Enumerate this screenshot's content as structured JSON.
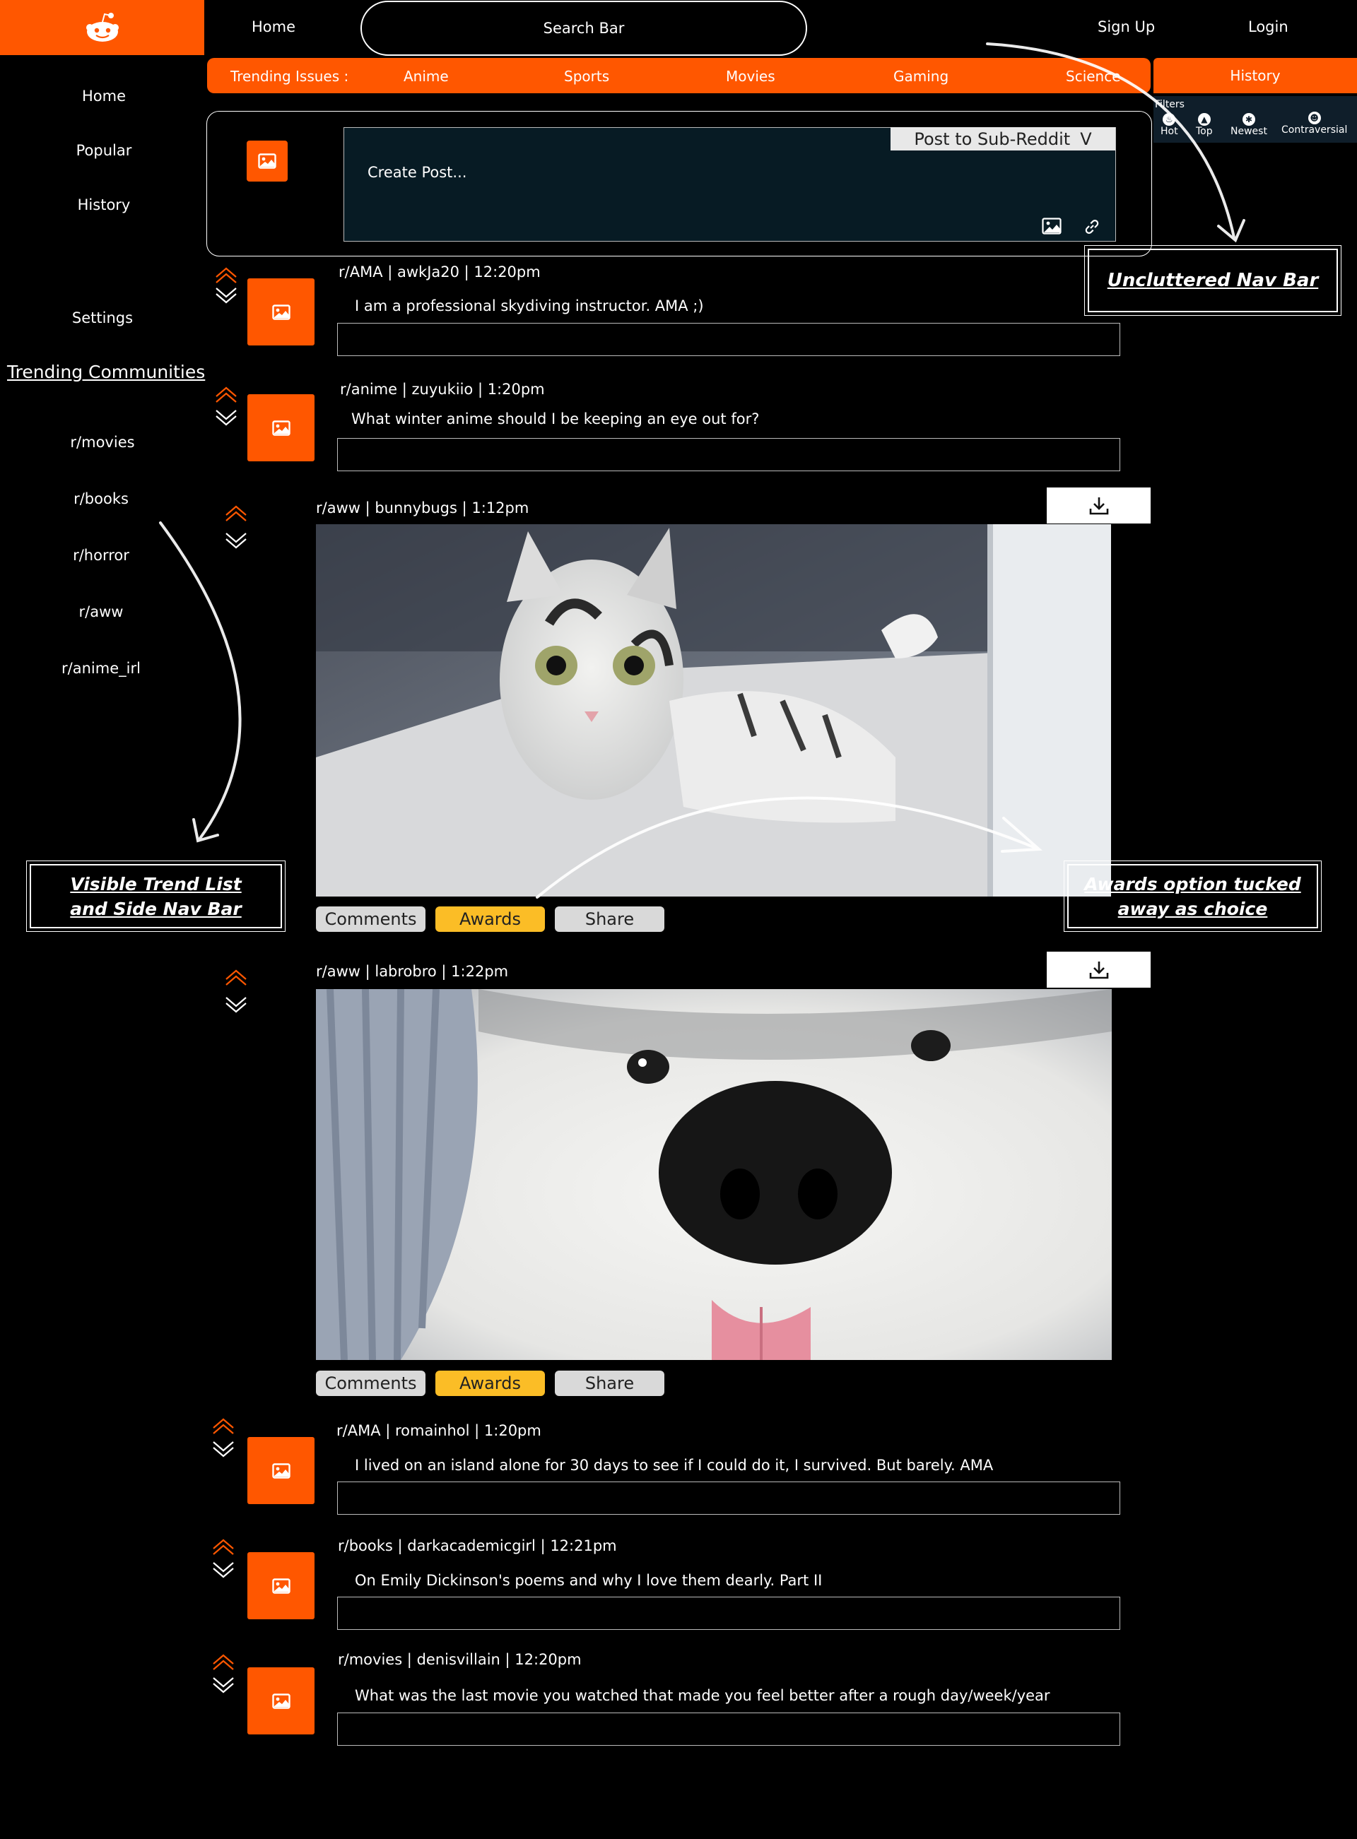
{
  "brand": {
    "logo_icon": "reddit-alien-icon",
    "accent": "#ff5700"
  },
  "topnav": {
    "home": "Home",
    "search": "Search Bar",
    "signup": "Sign Up",
    "login": "Login"
  },
  "trending": {
    "label": "Trending Issues :",
    "items": [
      "Anime",
      "Sports",
      "Movies",
      "Gaming",
      "Science"
    ],
    "history": "History"
  },
  "filters": {
    "label": "Filters",
    "items": [
      "Hot",
      "Top",
      "Newest",
      "Contraversial"
    ]
  },
  "sidebar": {
    "links": [
      "Home",
      "Popular",
      "History",
      "Settings"
    ],
    "trending_title": "Trending Communities",
    "communities": [
      "r/movies",
      "r/books",
      "r/horror",
      "r/aww",
      "r/anime_irl"
    ]
  },
  "create_post": {
    "placeholder": "Create Post...",
    "subreddit_select": "Post to Sub-Reddit",
    "subreddit_chevron": "V"
  },
  "posts": [
    {
      "meta": "r/AMA | awkJa20  | 12:20pm",
      "title": "I am a professional skydiving instructor. AMA ;)"
    },
    {
      "meta": "r/anime | zuyukiio  | 1:20pm",
      "title": "What winter anime should I be keeping an eye out for?"
    },
    {
      "meta": "r/aww | bunnybugs | 1:12pm",
      "image": "cat-photo"
    },
    {
      "meta": "r/aww | labrobro | 1:22pm",
      "image": "dog-photo"
    },
    {
      "meta": "r/AMA | romainhol  | 1:20pm",
      "title": "I lived on an island alone for 30 days to see if I could do it, I survived. But barely. AMA"
    },
    {
      "meta": "r/books | darkacademicgirl  | 12:21pm",
      "title": "On Emily Dickinson's poems and why I love them dearly. Part II"
    },
    {
      "meta": "r/movies | denisvillain  | 12:20pm",
      "title": "What was the last movie you watched that made you feel better after a rough day/week/year"
    }
  ],
  "post_actions": {
    "comments": "Comments",
    "awards": "Awards",
    "share": "Share"
  },
  "annotations": {
    "nav": "Uncluttered Nav Bar",
    "side_line1": "Visible Trend List",
    "side_line2": "and  Side Nav Bar",
    "awards_line1": "Awards option tucked",
    "awards_line2": "away as choice"
  }
}
